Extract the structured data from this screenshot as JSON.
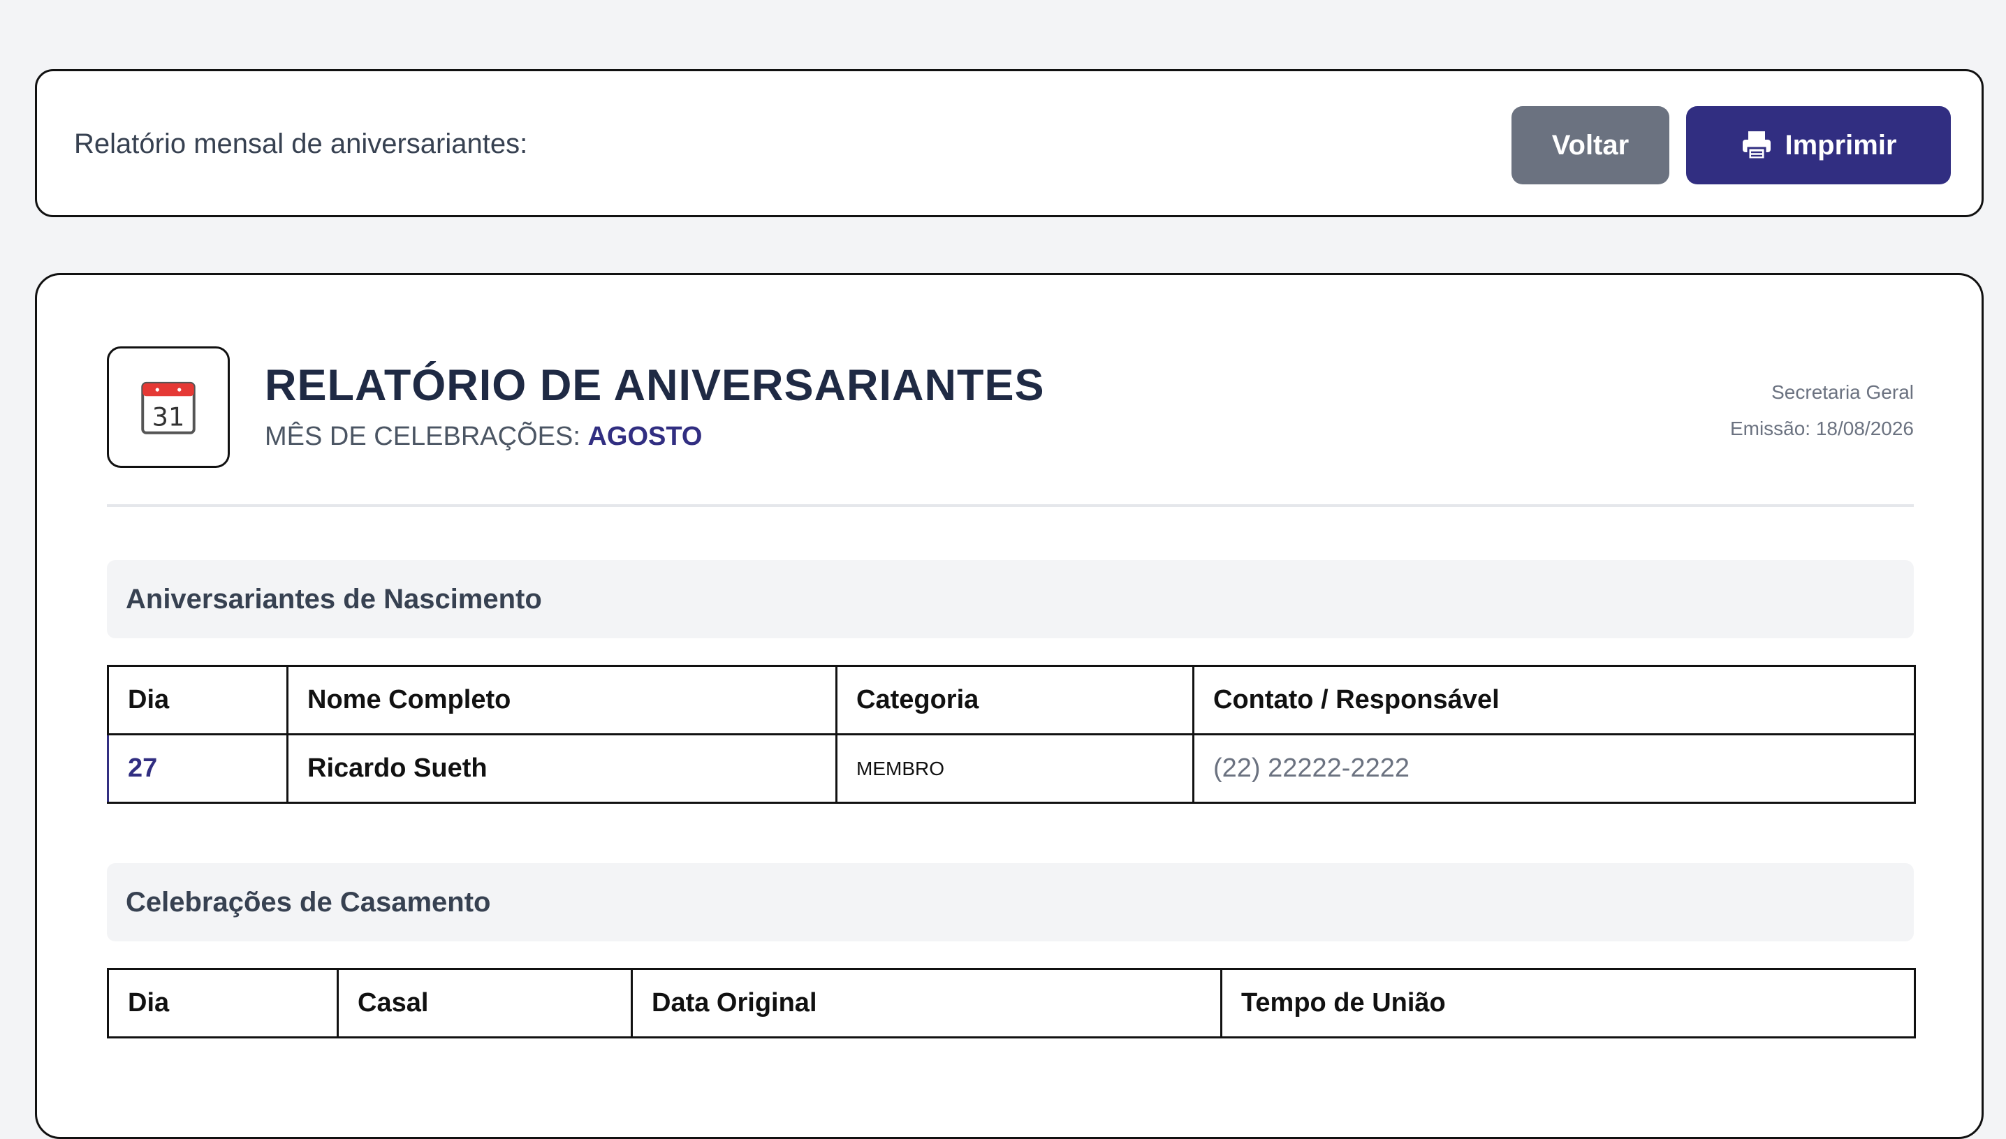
{
  "topbar": {
    "subtitle": "Relatório mensal de aniversariantes:",
    "back_label": "Voltar",
    "print_label": "Imprimir"
  },
  "report": {
    "title": "RELATÓRIO DE ANIVERSARIANTES",
    "month_prefix": "MÊS DE CELEBRAÇÕES:",
    "month": "AGOSTO",
    "calendar_day": "31",
    "org": "Secretaria Geral",
    "issued": "Emissão: 18/08/2026"
  },
  "births": {
    "heading": "Aniversariantes de Nascimento",
    "columns": [
      "Dia",
      "Nome Completo",
      "Categoria",
      "Contato / Responsável"
    ],
    "rows": [
      {
        "day": "27",
        "name": "Ricardo Sueth",
        "category": "MEMBRO",
        "contact": "(22) 22222-2222"
      }
    ]
  },
  "weddings": {
    "heading": "Celebrações de Casamento",
    "columns": [
      "Dia",
      "Casal",
      "Data Original",
      "Tempo de União"
    ],
    "rows": []
  },
  "colors": {
    "primary": "#312e81",
    "secondary_button": "#6b7280",
    "section_bg": "#f3f4f6"
  }
}
